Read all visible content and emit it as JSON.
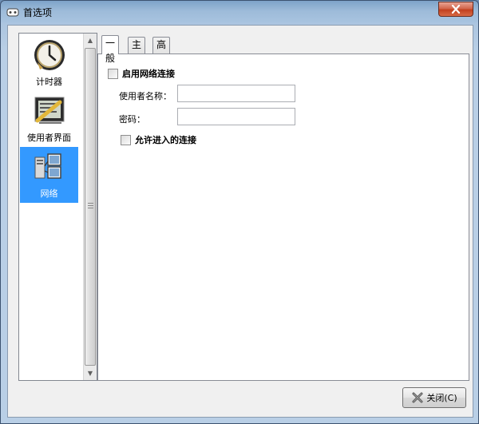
{
  "window": {
    "title": "首选项",
    "title_icon": "app-icon",
    "close_icon": "close-icon"
  },
  "sidebar": {
    "items": [
      {
        "label": "计时器",
        "icon": "clock-icon",
        "selected": false
      },
      {
        "label": "使用者界面",
        "icon": "interface-icon",
        "selected": false
      },
      {
        "label": "网络",
        "icon": "network-icon",
        "selected": true
      }
    ]
  },
  "tabs": [
    {
      "label": "一般",
      "active": true
    },
    {
      "label": "主机",
      "active": false
    },
    {
      "label": "高级",
      "active": false
    }
  ],
  "general": {
    "enable_network_label": "启用网络连接",
    "enable_network_checked": false,
    "username_label": "使用者名称：",
    "username_value": "",
    "password_label": "密码：",
    "password_value": "",
    "allow_incoming_label": "允许进入的连接",
    "allow_incoming_checked": false
  },
  "footer": {
    "close_label": "关闭(C)"
  },
  "colors": {
    "selection": "#3399ff",
    "close_red": "#c2401f",
    "frame": "#b9cfe6"
  }
}
